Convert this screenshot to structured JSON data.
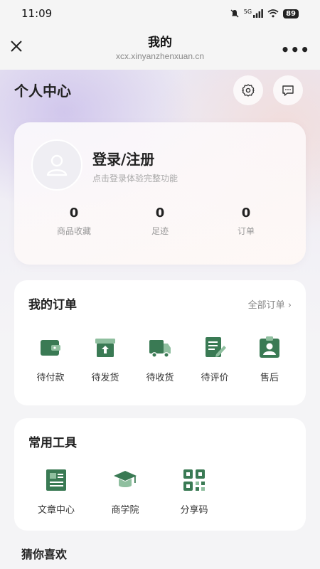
{
  "status_bar": {
    "time": "11:09",
    "network": "5G",
    "battery": "89"
  },
  "nav": {
    "title": "我的",
    "url": "xcx.xinyanzhenxuan.cn",
    "more": "•••"
  },
  "page_title": "个人中心",
  "profile": {
    "login_label": "登录/注册",
    "login_hint": "点击登录体验完整功能",
    "stats": [
      {
        "value": "0",
        "label": "商品收藏"
      },
      {
        "value": "0",
        "label": "足迹"
      },
      {
        "value": "0",
        "label": "订单"
      }
    ]
  },
  "orders": {
    "title": "我的订单",
    "all_label": "全部订单 ›",
    "items": [
      {
        "label": "待付款",
        "icon": "wallet-icon"
      },
      {
        "label": "待发货",
        "icon": "package-icon"
      },
      {
        "label": "待收货",
        "icon": "truck-icon"
      },
      {
        "label": "待评价",
        "icon": "review-icon"
      },
      {
        "label": "售后",
        "icon": "after-sales-icon"
      }
    ]
  },
  "tools": {
    "title": "常用工具",
    "items": [
      {
        "label": "文章中心",
        "icon": "article-icon"
      },
      {
        "label": "商学院",
        "icon": "graduation-cap-icon"
      },
      {
        "label": "分享码",
        "icon": "qr-code-icon"
      }
    ]
  },
  "guess_title": "猜你喜欢",
  "colors": {
    "accent_green": "#3a7a54",
    "accent_green_light": "#8fbf9f"
  }
}
